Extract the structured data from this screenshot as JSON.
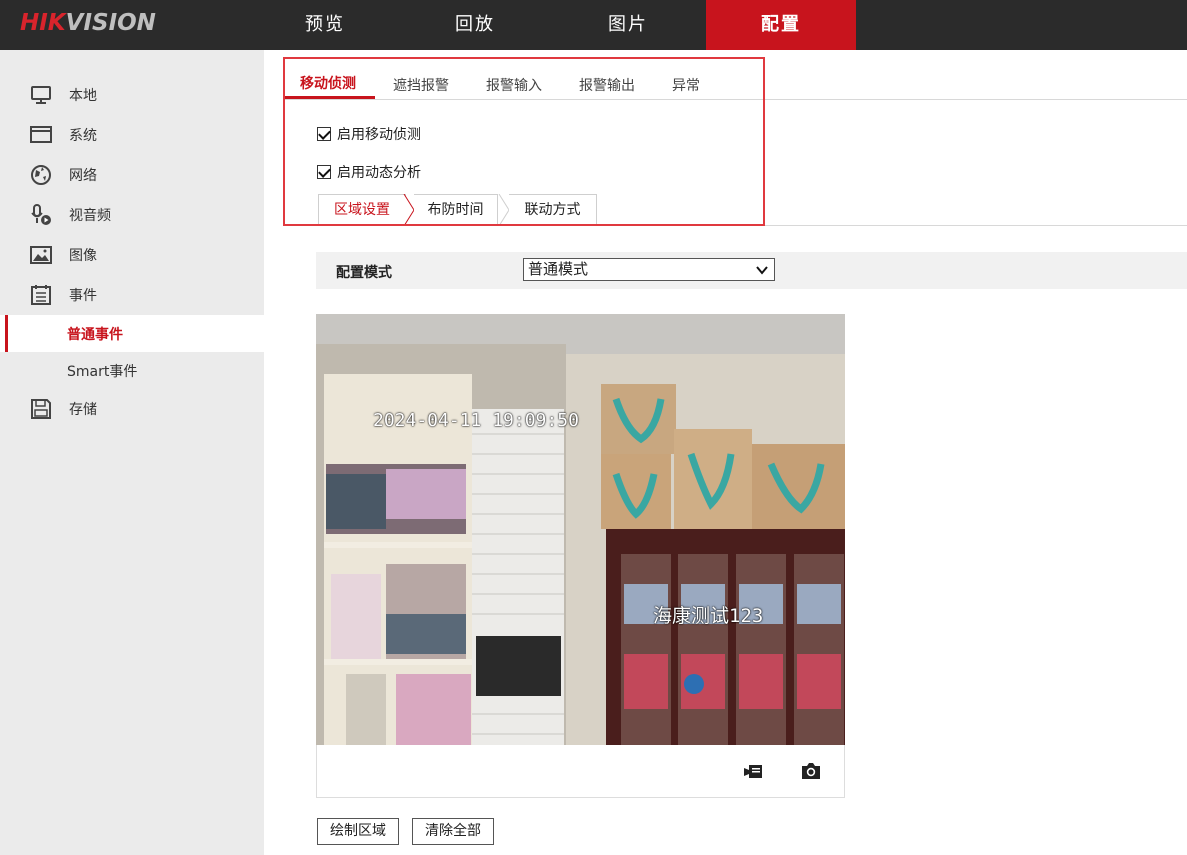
{
  "brand": {
    "logo_red": "HIK",
    "logo_gray": "VISION"
  },
  "topnav": [
    {
      "label": "预览"
    },
    {
      "label": "回放"
    },
    {
      "label": "图片"
    },
    {
      "label": "配置",
      "active": true
    }
  ],
  "sidebar": {
    "items": [
      {
        "label": "本地",
        "icon": "monitor-icon"
      },
      {
        "label": "系统",
        "icon": "window-icon"
      },
      {
        "label": "网络",
        "icon": "globe-icon"
      },
      {
        "label": "视音频",
        "icon": "mic-camera-icon"
      },
      {
        "label": "图像",
        "icon": "image-icon"
      },
      {
        "label": "事件",
        "icon": "calendar-icon"
      }
    ],
    "subitems": [
      {
        "label": "普通事件",
        "active": true
      },
      {
        "label": "Smart事件"
      }
    ],
    "storage": {
      "label": "存储",
      "icon": "floppy-icon"
    }
  },
  "tabs": [
    {
      "label": "移动侦测",
      "active": true
    },
    {
      "label": "遮挡报警"
    },
    {
      "label": "报警输入"
    },
    {
      "label": "报警输出"
    },
    {
      "label": "异常"
    }
  ],
  "checkboxes": {
    "enable_motion": "启用移动侦测",
    "enable_dynamic": "启用动态分析"
  },
  "subtabs": [
    {
      "label": "区域设置",
      "active": true
    },
    {
      "label": "布防时间"
    },
    {
      "label": "联动方式"
    }
  ],
  "config_mode": {
    "label": "配置模式",
    "value": "普通模式"
  },
  "video": {
    "timestamp": "2024-04-11 19:09:50",
    "channel_name": "海康测试123"
  },
  "buttons": {
    "draw_area": "绘制区域",
    "clear_all": "清除全部"
  },
  "colors": {
    "accent": "#c8141d",
    "topbar": "#2b2b2b",
    "sidebar": "#ebebeb",
    "highlight": "#e0393f"
  }
}
